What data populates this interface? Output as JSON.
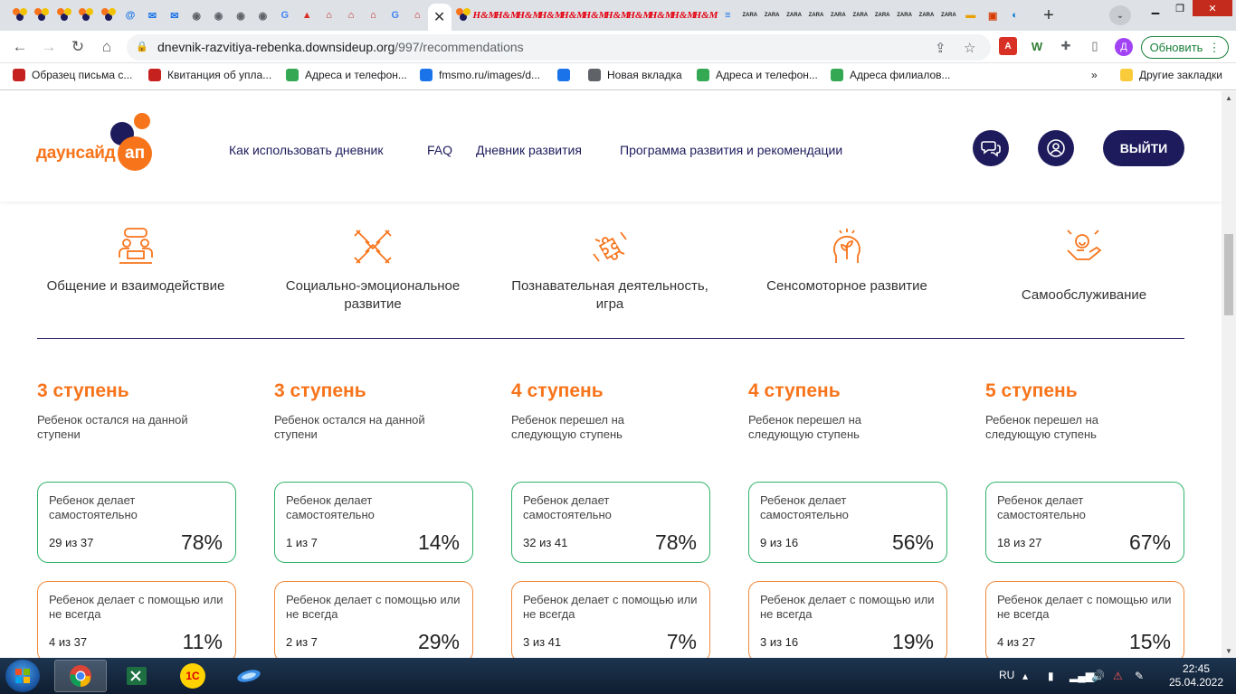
{
  "browser": {
    "url_host": "dnevnik-razvitiya-rebenka.downsideup.org",
    "url_path": "/997/recommendations",
    "update_label": "Обновить",
    "profile_initial": "Д",
    "close_tab": "✕",
    "tab_favicons": {
      "hm": "H&M",
      "zara": "ZARA"
    },
    "bookmarks": [
      {
        "label": "Образец письма с...",
        "color": "#c5221f"
      },
      {
        "label": "Квитанция об упла...",
        "color": "#c5221f"
      },
      {
        "label": "Адреса и телефон...",
        "color": "#34a853"
      },
      {
        "label": "fmsmo.ru/images/d...",
        "color": "#1a73e8"
      },
      {
        "label": "",
        "color": "#1a73e8"
      },
      {
        "label": "Новая вкладка",
        "color": "#5f6368"
      },
      {
        "label": "Адреса и телефон...",
        "color": "#34a853"
      },
      {
        "label": "Адреса филиалов...",
        "color": "#34a853"
      }
    ],
    "bookmarks_more": "»",
    "other_bookmarks": "Другие закладки"
  },
  "site": {
    "logo_word": "даунсайд",
    "logo_ap": "ап",
    "nav": [
      "Как использовать дневник",
      "FAQ",
      "Дневник развития",
      "Программа развития и рекомендации"
    ],
    "logout": "ВЫЙТИ"
  },
  "categories": [
    {
      "label": "Общение и взаимодействие",
      "icon": "people-talk-icon"
    },
    {
      "label": "Социально-эмоциональное развитие",
      "icon": "hands-cross-icon"
    },
    {
      "label": "Познавательная деятельность, игра",
      "icon": "puzzle-hands-icon"
    },
    {
      "label": "Сенсомоторное развитие",
      "icon": "head-sprout-icon"
    },
    {
      "label": "Самообслуживание",
      "icon": "hand-care-icon"
    }
  ],
  "columns": [
    {
      "stage": "3 ступень",
      "desc": "Ребенок остался на данной ступени",
      "green": {
        "label": "Ребенок делает самостоятельно",
        "count": "29 из 37",
        "pct": "78%"
      },
      "orange": {
        "label": "Ребенок делает с помощью или не всегда",
        "count": "4 из 37",
        "pct": "11%"
      }
    },
    {
      "stage": "3 ступень",
      "desc": "Ребенок остался на данной ступени",
      "green": {
        "label": "Ребенок делает самостоятельно",
        "count": "1 из 7",
        "pct": "14%"
      },
      "orange": {
        "label": "Ребенок делает с помощью или не всегда",
        "count": "2 из 7",
        "pct": "29%"
      }
    },
    {
      "stage": "4 ступень",
      "desc": "Ребенок перешел на следующую ступень",
      "green": {
        "label": "Ребенок делает самостоятельно",
        "count": "32 из 41",
        "pct": "78%"
      },
      "orange": {
        "label": "Ребенок делает с помощью или не всегда",
        "count": "3 из 41",
        "pct": "7%"
      }
    },
    {
      "stage": "4 ступень",
      "desc": "Ребенок перешел на следующую ступень",
      "green": {
        "label": "Ребенок делает самостоятельно",
        "count": "9 из 16",
        "pct": "56%"
      },
      "orange": {
        "label": "Ребенок делает с помощью или не всегда",
        "count": "3 из 16",
        "pct": "19%"
      }
    },
    {
      "stage": "5 ступень",
      "desc": "Ребенок перешел на следующую ступень",
      "green": {
        "label": "Ребенок делает самостоятельно",
        "count": "18 из 27",
        "pct": "67%"
      },
      "orange": {
        "label": "Ребенок делает с помощью или не всегда",
        "count": "4 из 27",
        "pct": "15%"
      }
    }
  ],
  "colors": {
    "brand_orange": "#f7741b",
    "brand_navy": "#1e1b5c",
    "green_border": "#2fb36a",
    "orange_border": "#f08a3c"
  },
  "taskbar": {
    "lang": "RU",
    "time": "22:45",
    "date": "25.04.2022",
    "app_1c": "1С"
  }
}
